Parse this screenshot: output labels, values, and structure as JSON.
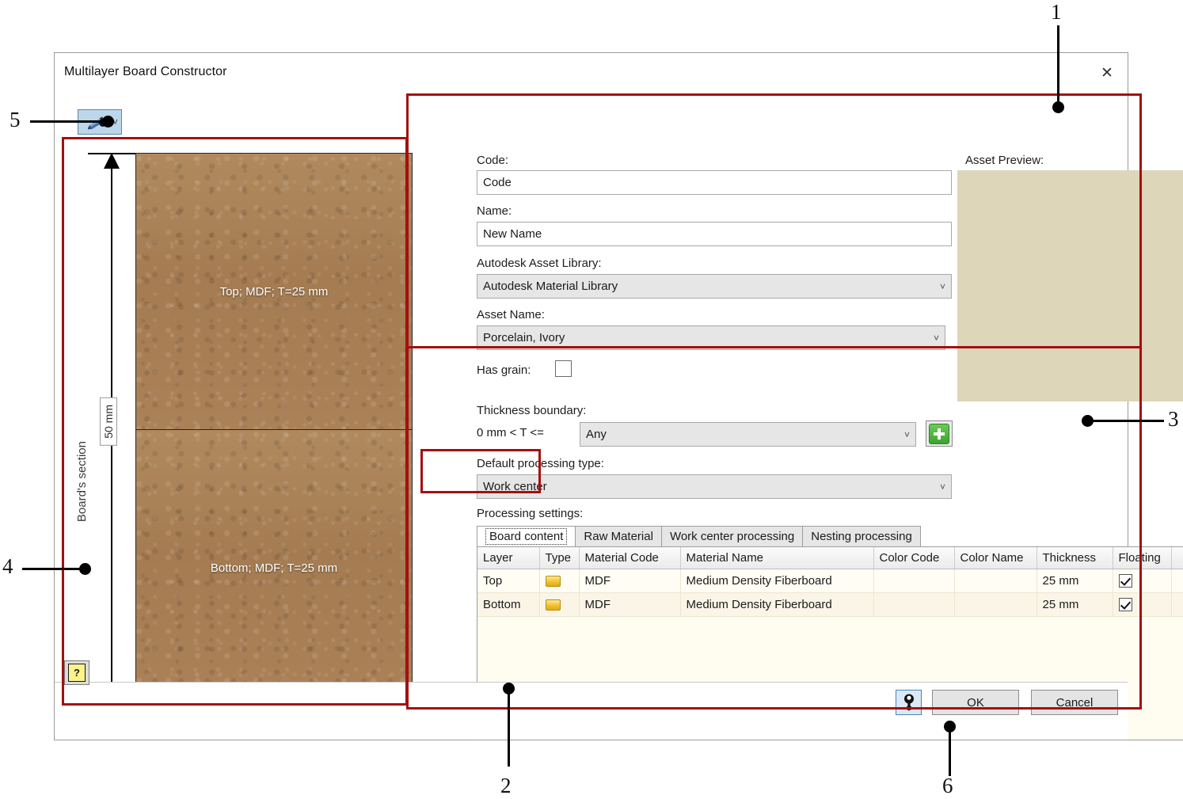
{
  "dialog": {
    "title": "Multilayer Board Constructor",
    "close_icon": "close-icon"
  },
  "toolbar": {
    "edit_tool_icon": "pen-tool-icon",
    "dropdown_chevron": "˅"
  },
  "board_preview": {
    "axis_label": "Board's section",
    "total_thickness": "50 mm",
    "layers": [
      {
        "caption": "Top; MDF; T=25 mm"
      },
      {
        "caption": "Bottom; MDF; T=25 mm"
      }
    ]
  },
  "form": {
    "code_label": "Code:",
    "code_value": "Code",
    "name_label": "Name:",
    "name_value": "New Name",
    "library_label": "Autodesk Asset Library:",
    "library_value": "Autodesk Material Library",
    "asset_label": "Asset Name:",
    "asset_value": "Porcelain, Ivory",
    "grain_label": "Has grain:",
    "grain_checked": false,
    "preview_label": "Asset Preview:",
    "preview_color": "#ddd6b8",
    "chevron": "˅"
  },
  "thickness": {
    "label": "Thickness boundary:",
    "prefix": "0 mm < T <=",
    "value": "Any",
    "add_button_icon": "plus-icon"
  },
  "processing": {
    "type_label": "Default processing type:",
    "type_value": "Work center",
    "settings_label": "Processing settings:",
    "tabs": [
      {
        "label": "Board content",
        "active": true
      },
      {
        "label": "Raw Material",
        "active": false
      },
      {
        "label": "Work center processing",
        "active": false
      },
      {
        "label": "Nesting processing",
        "active": false
      }
    ]
  },
  "grid": {
    "columns": [
      "Layer",
      "Type",
      "Material Code",
      "Material Name",
      "Color Code",
      "Color Name",
      "Thickness",
      "Floating",
      ""
    ],
    "rows": [
      {
        "layer": "Top",
        "type_icon": "folder-icon",
        "material_code": "MDF",
        "material_name": "Medium Density Fiberboard",
        "color_code": "",
        "color_name": "",
        "thickness": "25 mm",
        "floating": true
      },
      {
        "layer": "Bottom",
        "type_icon": "folder-icon",
        "material_code": "MDF",
        "material_name": "Medium Density Fiberboard",
        "color_code": "",
        "color_name": "",
        "thickness": "25 mm",
        "floating": true
      }
    ]
  },
  "footer": {
    "help_label": "?",
    "pin_icon": "pin-icon",
    "ok_label": "OK",
    "cancel_label": "Cancel"
  },
  "annotations": {
    "highlight_color": "#a40f10",
    "callouts": [
      {
        "number": "1",
        "target": "asset-preview-area"
      },
      {
        "number": "2",
        "target": "processing-settings-grid"
      },
      {
        "number": "3",
        "target": "thickness-and-processing-panel"
      },
      {
        "number": "4",
        "target": "board-section-preview"
      },
      {
        "number": "5",
        "target": "edit-tool-button"
      },
      {
        "number": "6",
        "target": "pin-button"
      }
    ]
  }
}
